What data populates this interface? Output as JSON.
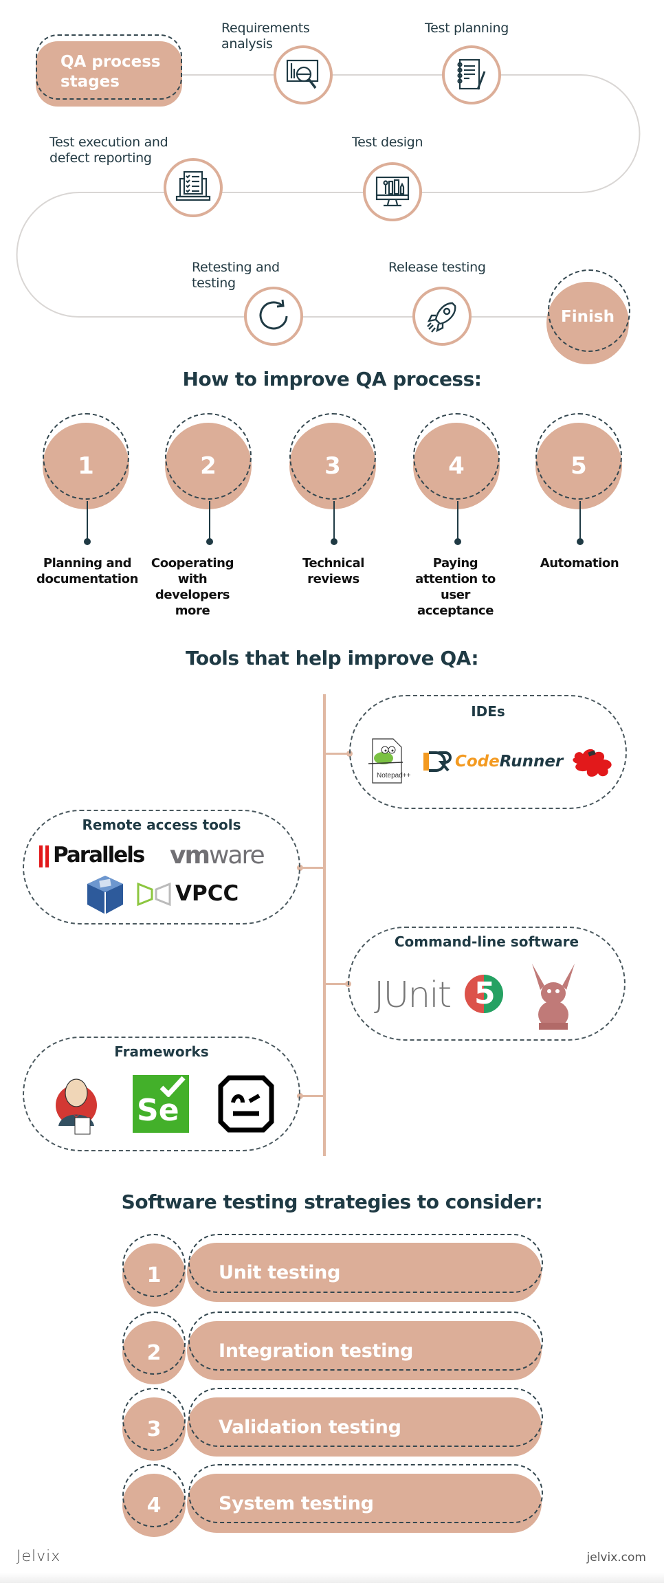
{
  "colors": {
    "accent": "#dcae98",
    "dark": "#1f3a44",
    "path": "#d9d6d4",
    "white": "#ffffff"
  },
  "process": {
    "start_label": "QA process stages",
    "finish_label": "Finish",
    "stages": [
      {
        "label": "Requirements analysis",
        "icon": "magnifier-chart-icon"
      },
      {
        "label": "Test planning",
        "icon": "notebook-pencil-icon"
      },
      {
        "label": "Test design",
        "icon": "monitor-design-icon"
      },
      {
        "label": "Test execution and defect reporting",
        "icon": "laptop-checklist-icon"
      },
      {
        "label": "Retesting and testing",
        "icon": "refresh-icon"
      },
      {
        "label": "Release testing",
        "icon": "rocket-icon"
      }
    ]
  },
  "improve": {
    "title": "How to improve QA process:",
    "items": [
      {
        "number": "1",
        "label": "Planning and documentation"
      },
      {
        "number": "2",
        "label": "Cooperating with developers more"
      },
      {
        "number": "3",
        "label": "Technical reviews"
      },
      {
        "number": "4",
        "label": "Paying attention to user acceptance"
      },
      {
        "number": "5",
        "label": "Automation"
      }
    ]
  },
  "tools": {
    "title": "Tools that help improve QA:",
    "groups": [
      {
        "title": "IDEs",
        "logos": [
          "Notepad++",
          "CodeRunner",
          "Puzzle IDE"
        ]
      },
      {
        "title": "Remote access tools",
        "logos": [
          "Parallels",
          "vmware",
          "VirtualBox",
          "VPCC"
        ]
      },
      {
        "title": "Command-line software",
        "logos": [
          "JUnit 5",
          "Gargoyle"
        ]
      },
      {
        "title": "Frameworks",
        "logos": [
          "Jenkins",
          "Selenium",
          "Robot Framework"
        ]
      }
    ],
    "logo_text": {
      "notepad": "Notepad++",
      "coderunner_code": "Code",
      "coderunner_runner": "Runner",
      "parallels": "Parallels",
      "vmware_vm": "vm",
      "vmware_ware": "ware",
      "vpcc": "VPCC",
      "junit": "JUnit",
      "junit_num": "5",
      "selenium": "Se"
    }
  },
  "strategies": {
    "title": "Software testing strategies to consider:",
    "items": [
      {
        "number": "1",
        "label": "Unit testing"
      },
      {
        "number": "2",
        "label": "Integration testing"
      },
      {
        "number": "3",
        "label": "Validation testing"
      },
      {
        "number": "4",
        "label": "System testing"
      }
    ]
  },
  "footer": {
    "brand": "Jelvix",
    "site": "jelvix.com"
  }
}
